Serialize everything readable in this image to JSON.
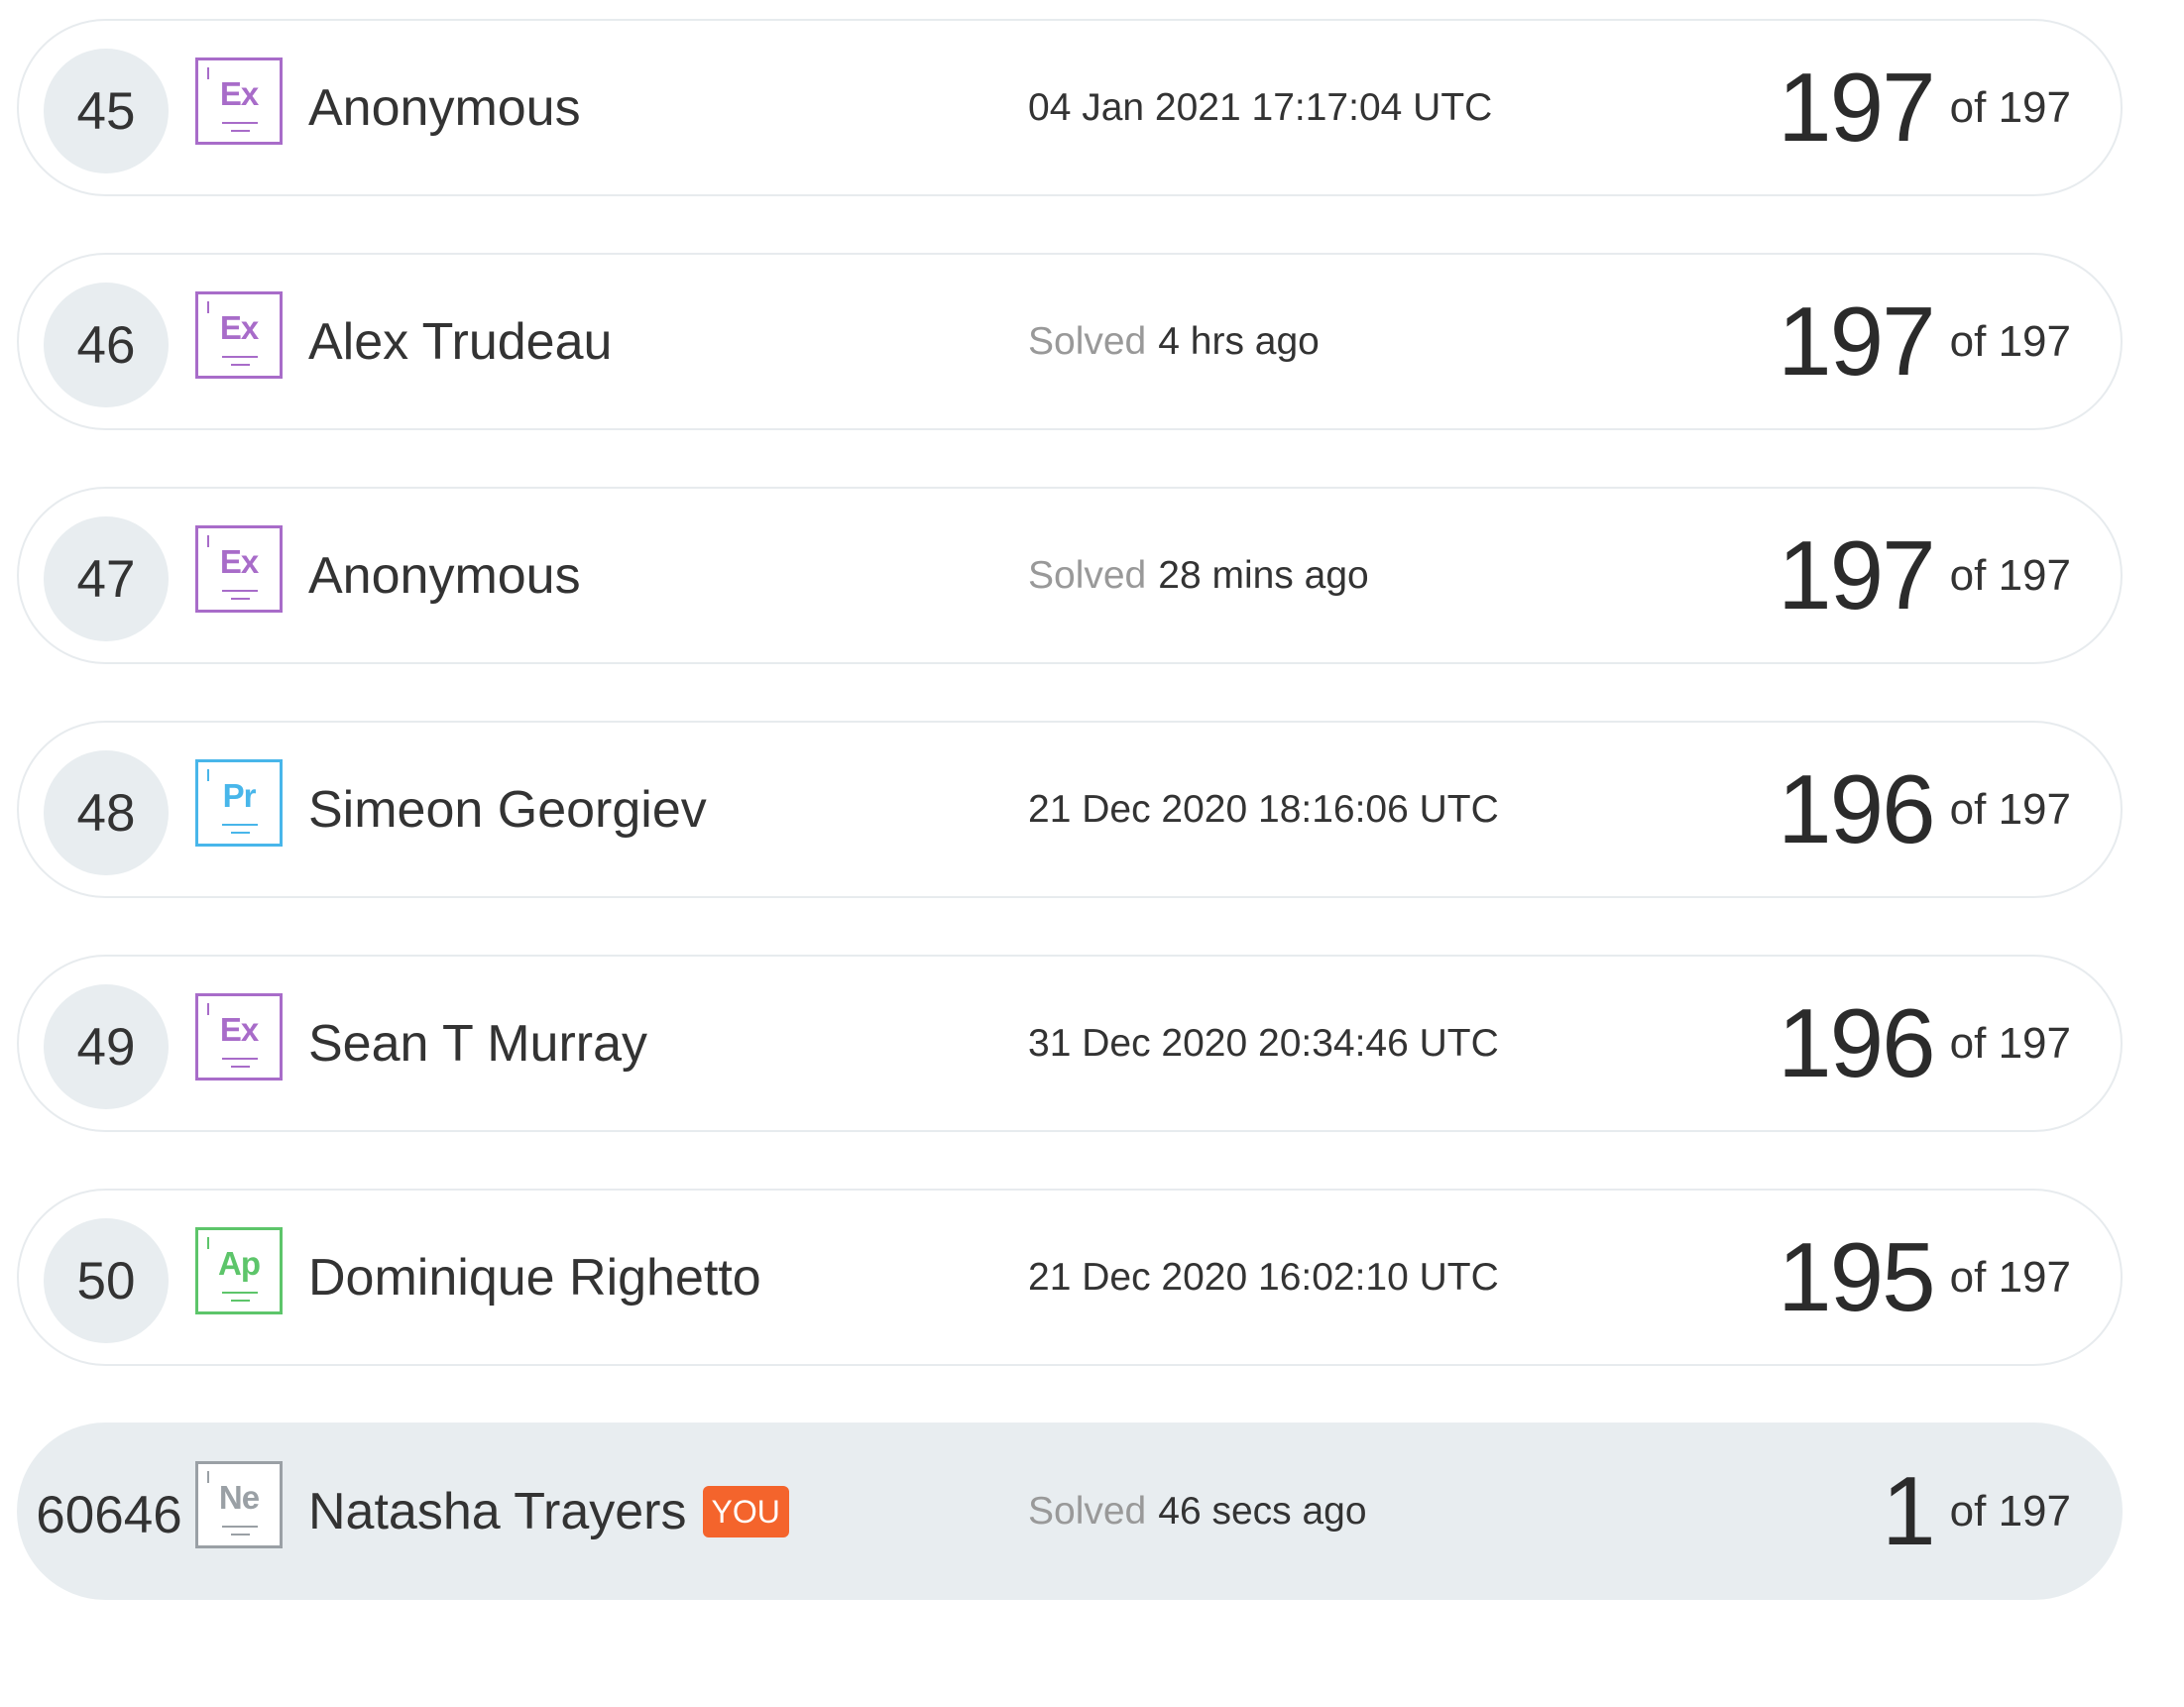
{
  "leaderboard": {
    "rows": [
      {
        "rank": "45",
        "badge": "Ex",
        "name": "Anonymous",
        "solved_prefix": "",
        "solved_time": "04 Jan 2021 17:17:04 UTC",
        "score": "197",
        "total": "of 197"
      },
      {
        "rank": "46",
        "badge": "Ex",
        "name": "Alex Trudeau",
        "solved_prefix": "Solved",
        "solved_time": "4 hrs ago",
        "score": "197",
        "total": "of 197"
      },
      {
        "rank": "47",
        "badge": "Ex",
        "name": "Anonymous",
        "solved_prefix": "Solved",
        "solved_time": "28 mins ago",
        "score": "197",
        "total": "of 197"
      },
      {
        "rank": "48",
        "badge": "Pr",
        "name": "Simeon Georgiev",
        "solved_prefix": "",
        "solved_time": "21 Dec 2020 18:16:06 UTC",
        "score": "196",
        "total": "of 197"
      },
      {
        "rank": "49",
        "badge": "Ex",
        "name": "Sean T Murray",
        "solved_prefix": "",
        "solved_time": "31 Dec 2020 20:34:46 UTC",
        "score": "196",
        "total": "of 197"
      },
      {
        "rank": "50",
        "badge": "Ap",
        "name": "Dominique Righetto",
        "solved_prefix": "",
        "solved_time": "21 Dec 2020 16:02:10 UTC",
        "score": "195",
        "total": "of 197"
      },
      {
        "rank": "60646",
        "badge": "Ne",
        "name": "Natasha Trayers",
        "you_label": "YOU",
        "solved_prefix": "Solved",
        "solved_time": "46 secs ago",
        "score": "1",
        "total": "of 197"
      }
    ]
  },
  "colors": {
    "ex": "#a86cc9",
    "pr": "#48b6ea",
    "ap": "#5dc56a",
    "ne": "#9aa0a5",
    "you_tag": "#f4642c",
    "row_border": "#e7ebee",
    "highlight_row": "#e8edf0"
  }
}
